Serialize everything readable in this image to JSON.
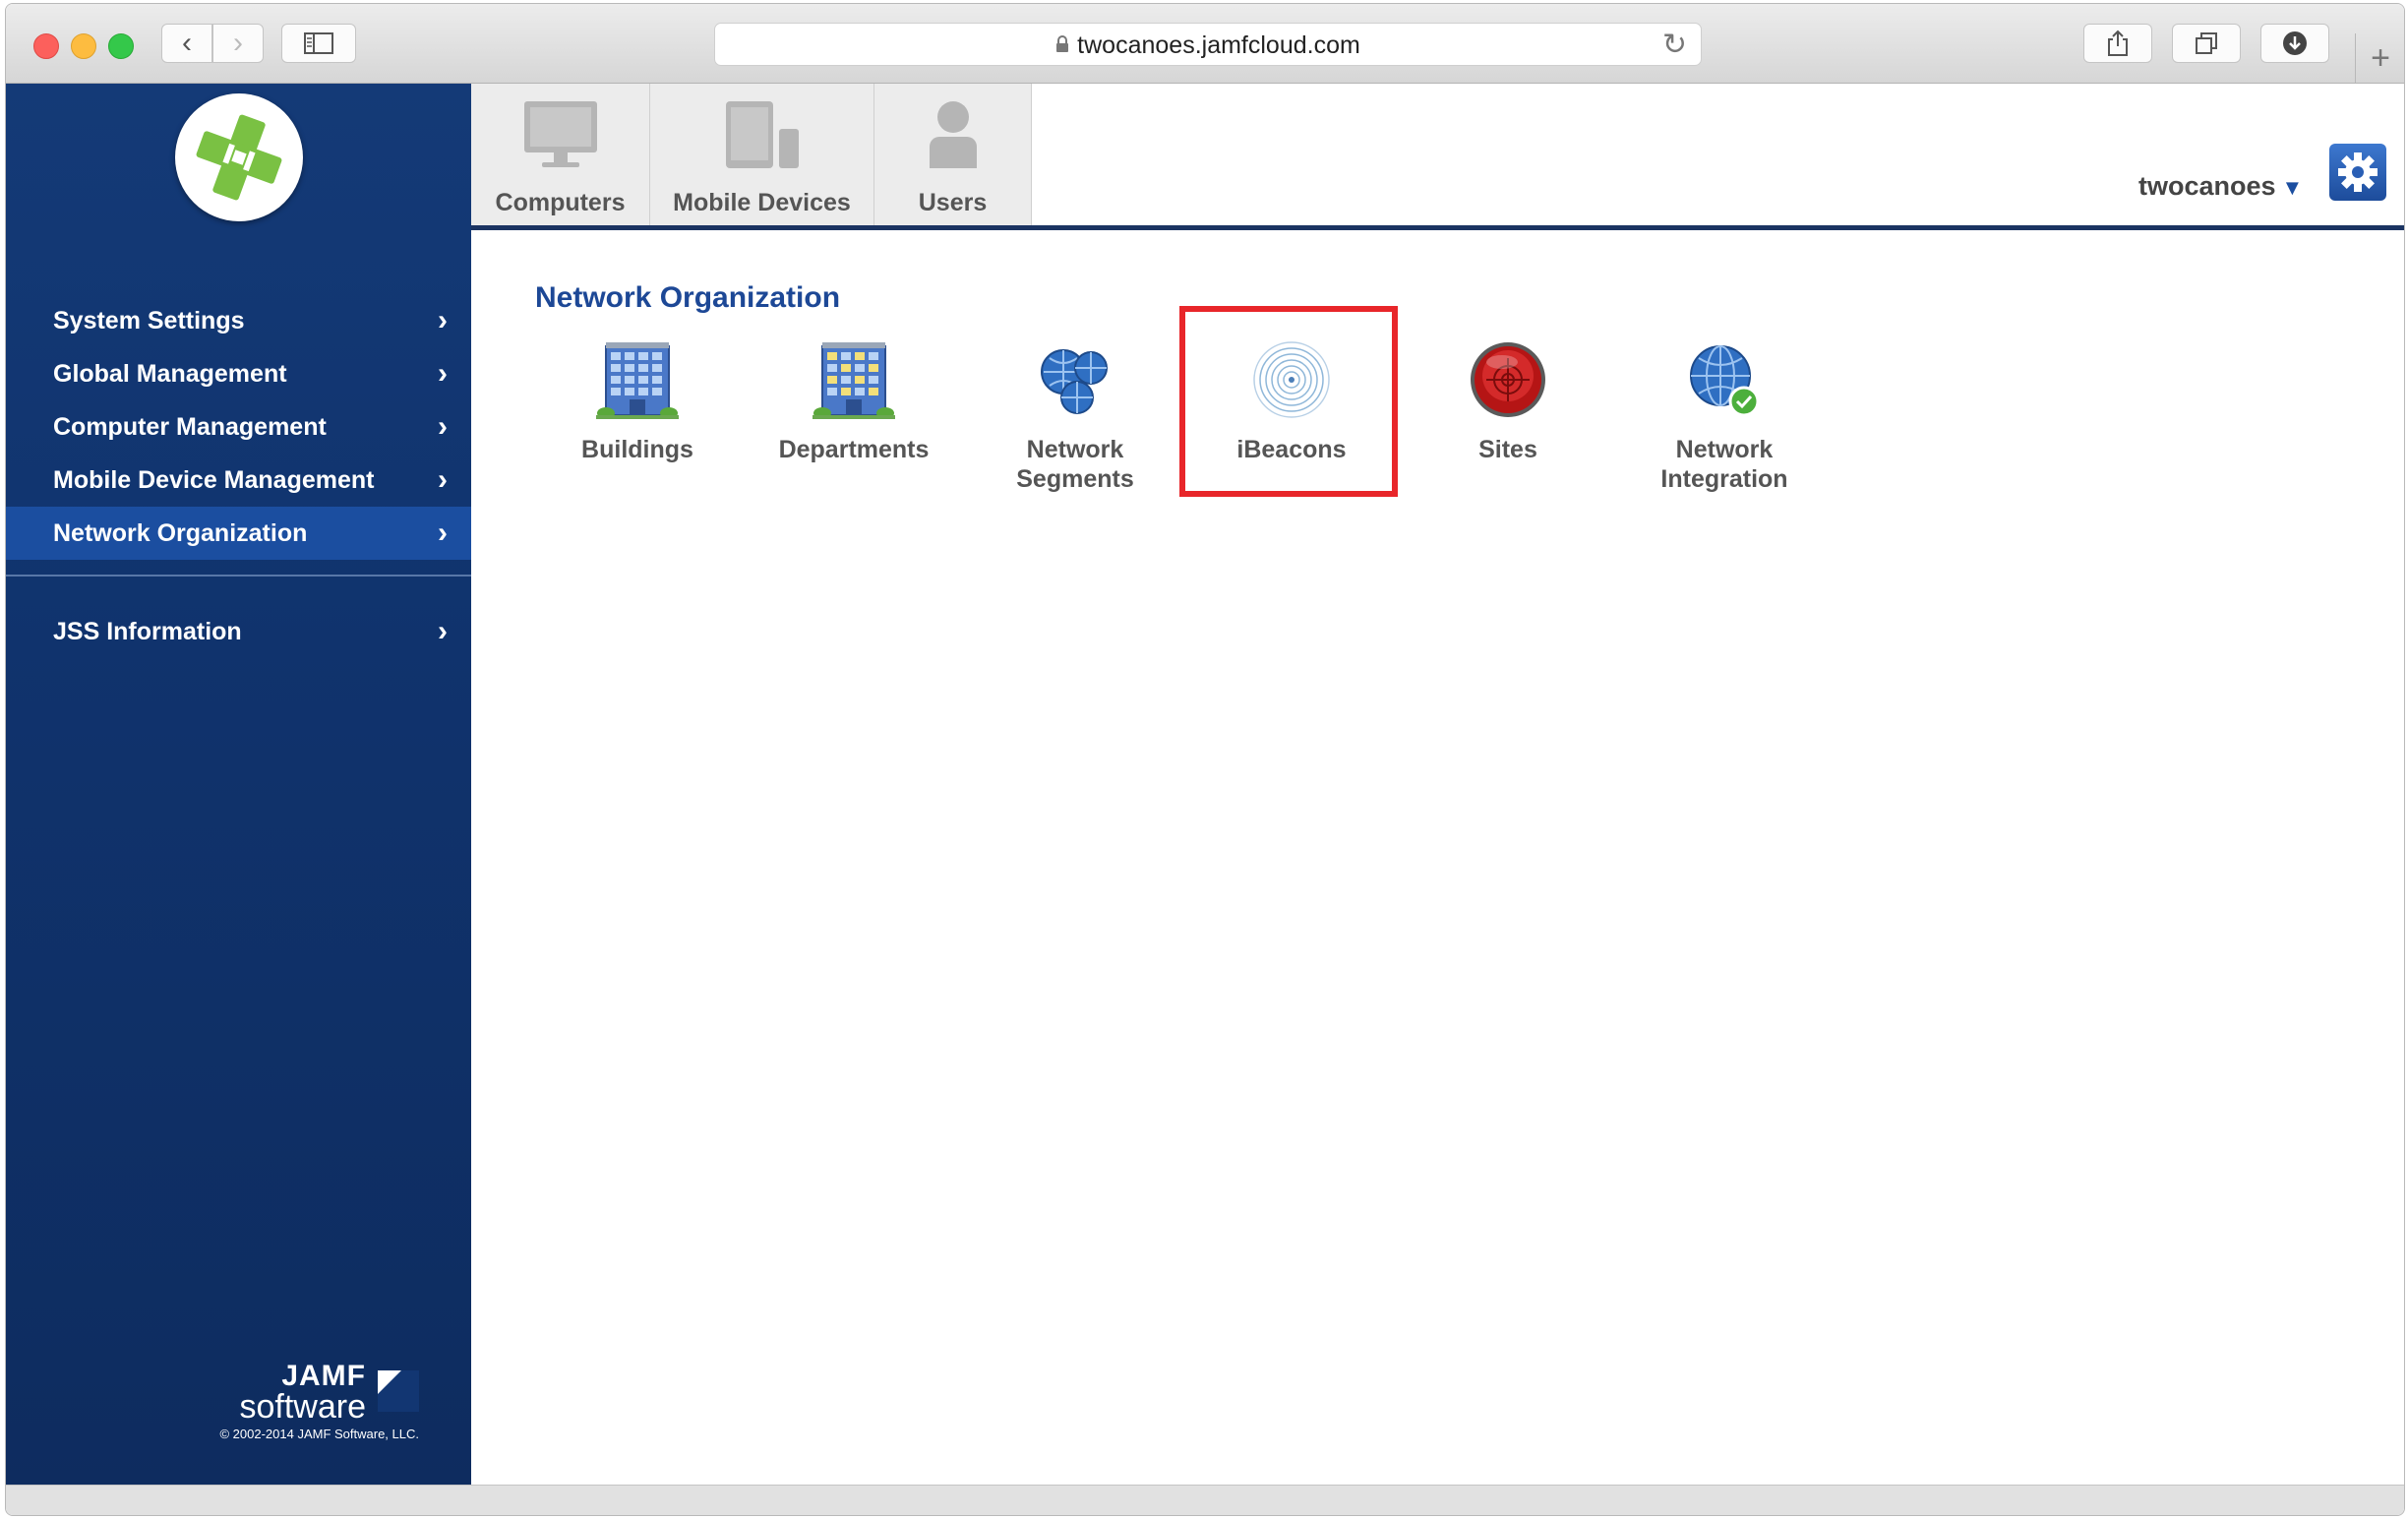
{
  "browser": {
    "url": "twocanoes.jamfcloud.com",
    "new_tab": "+"
  },
  "top_tabs": [
    {
      "label": "Computers",
      "icon": "monitor-icon"
    },
    {
      "label": "Mobile Devices",
      "icon": "devices-icon"
    },
    {
      "label": "Users",
      "icon": "user-icon"
    }
  ],
  "user": {
    "name": "twocanoes",
    "caret": "▼"
  },
  "sidebar": {
    "items": [
      {
        "label": "System Settings"
      },
      {
        "label": "Global Management"
      },
      {
        "label": "Computer Management"
      },
      {
        "label": "Mobile Device Management"
      },
      {
        "label": "Network Organization",
        "active": true
      },
      {
        "label": "JSS Information"
      }
    ],
    "brand": {
      "jamf": "JAMF",
      "software": "software",
      "copyright": "© 2002-2014 JAMF Software, LLC."
    }
  },
  "main": {
    "title": "Network Organization",
    "items": [
      {
        "line1": "Buildings",
        "line2": "",
        "icon": "building-icon"
      },
      {
        "line1": "Departments",
        "line2": "",
        "icon": "department-icon"
      },
      {
        "line1": "Network",
        "line2": "Segments",
        "icon": "globe-network-icon"
      },
      {
        "line1": "iBeacons",
        "line2": "",
        "icon": "ibeacon-icon",
        "highlighted": true
      },
      {
        "line1": "Sites",
        "line2": "",
        "icon": "target-icon"
      },
      {
        "line1": "Network",
        "line2": "Integration",
        "icon": "globe-check-icon"
      }
    ]
  },
  "colors": {
    "nav_bg": "#123672",
    "nav_active": "#1b4ea0",
    "title_blue": "#1d4896",
    "highlight_red": "#e8262a"
  }
}
